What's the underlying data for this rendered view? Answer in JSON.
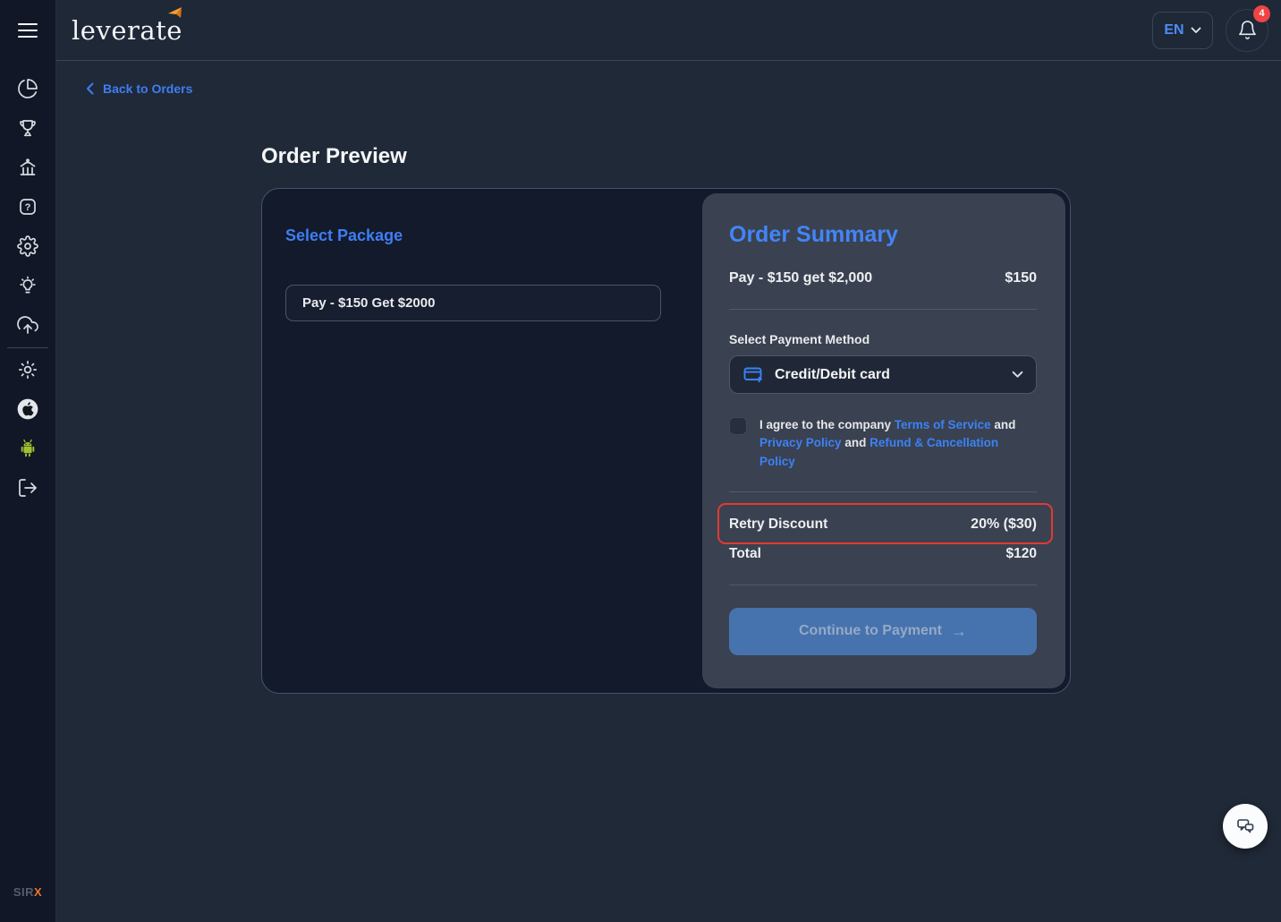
{
  "header": {
    "logo_text": "leverate",
    "language_selector": "EN",
    "notification_badge": "4"
  },
  "sidebar": {
    "icons": [
      "menu",
      "pie-chart",
      "trophy",
      "bank",
      "help",
      "settings",
      "idea",
      "cloud-upload",
      "brightness",
      "apple",
      "android",
      "logout"
    ],
    "brand_prefix": "SIR",
    "brand_suffix": "X"
  },
  "navigation": {
    "back_link": "Back to Orders"
  },
  "page": {
    "title": "Order Preview"
  },
  "package_panel": {
    "heading": "Select Package",
    "selected_package": "Pay - $150 Get $2000"
  },
  "order_summary": {
    "heading": "Order Summary",
    "line_item": {
      "label": "Pay - $150 get $2,000",
      "amount": "$150"
    },
    "payment": {
      "label": "Select Payment Method",
      "selected_method": "Credit/Debit card"
    },
    "terms": {
      "prefix": "I agree to the company ",
      "link_terms": "Terms of Service",
      "conj1": " and ",
      "link_privacy": "Privacy Policy",
      "conj2": " and ",
      "link_refund": "Refund & Cancellation Policy"
    },
    "discount": {
      "label": "Retry Discount",
      "value": "20% ($30)"
    },
    "total": {
      "label": "Total",
      "value": "$120"
    },
    "continue_button": "Continue to Payment",
    "continue_arrow": "→"
  },
  "colors": {
    "accent_blue": "#3B82F6",
    "annotation_red": "#E23B30",
    "badge_red": "#EF4444",
    "button_blue": "#4673AE",
    "android_green": "#9FC131",
    "logo_orange": "#F08A24"
  }
}
